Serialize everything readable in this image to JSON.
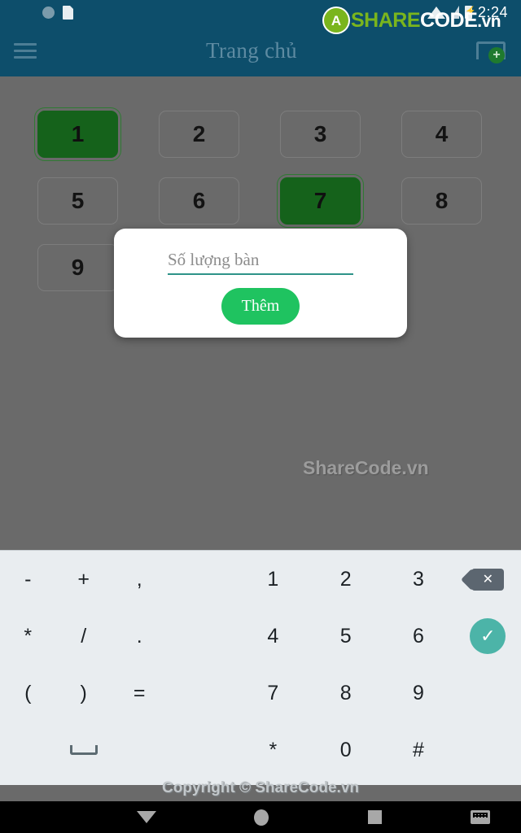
{
  "status_bar": {
    "clock": "2:24",
    "icons_left": [
      "circle-indicator-icon",
      "sd-card-icon"
    ],
    "icons_right": [
      "wifi-icon",
      "signal-icon",
      "battery-charging-icon"
    ],
    "background_color": "#0d4e6b"
  },
  "watermark": {
    "logo_badge": "A",
    "logo_part1": "SHARE",
    "logo_part2": "CODE",
    "logo_part3": ".vn",
    "center_text": "ShareCode.vn",
    "footer_text": "Copyright © ShareCode.vn",
    "brand_green": "#7ab51d"
  },
  "app_bar": {
    "menu_label": "menu",
    "title": "Trang chủ",
    "add_button_label": "add-table",
    "plus_glyph": "+",
    "background_color": "#0d4e6b",
    "title_color": "#5e8ba2"
  },
  "main": {
    "free_color": "#6a6a6a",
    "busy_color": "#15621b",
    "tables": [
      {
        "label": "1",
        "state": "busy"
      },
      {
        "label": "2",
        "state": "free"
      },
      {
        "label": "3",
        "state": "free"
      },
      {
        "label": "4",
        "state": "free"
      },
      {
        "label": "5",
        "state": "free"
      },
      {
        "label": "6",
        "state": "free"
      },
      {
        "label": "7",
        "state": "busy"
      },
      {
        "label": "8",
        "state": "free"
      },
      {
        "label": "9",
        "state": "free"
      }
    ]
  },
  "dialog": {
    "input_value": "",
    "input_placeholder": "Số lượng bàn",
    "underline_color": "#2e9388",
    "submit_label": "Thêm",
    "submit_color": "#1fc360"
  },
  "keyboard": {
    "background_color": "#e9edf0",
    "rows": [
      {
        "symbols": [
          "-",
          "+",
          ","
        ],
        "numbers": [
          "1",
          "2",
          "3"
        ],
        "action": "backspace-icon",
        "action_glyph": "✕"
      },
      {
        "symbols": [
          "*",
          "/",
          "."
        ],
        "numbers": [
          "4",
          "5",
          "6"
        ],
        "action": "enter-icon",
        "action_glyph": "✓"
      },
      {
        "symbols": [
          "(",
          ")",
          "="
        ],
        "numbers": [
          "7",
          "8",
          "9"
        ],
        "action": "",
        "action_glyph": ""
      },
      {
        "symbols": [
          "",
          "space-icon",
          ""
        ],
        "numbers": [
          "*",
          "0",
          "#"
        ],
        "action": "",
        "action_glyph": ""
      }
    ],
    "enter_color": "#4cb4a8",
    "backspace_color": "#5c6670"
  },
  "nav_bar": {
    "background_color": "#000000",
    "items": [
      {
        "name": "back-icon",
        "label": "back"
      },
      {
        "name": "home-icon",
        "label": "home"
      },
      {
        "name": "recents-icon",
        "label": "recents"
      },
      {
        "name": "keyboard-toggle-icon",
        "label": "keyboard"
      }
    ]
  }
}
